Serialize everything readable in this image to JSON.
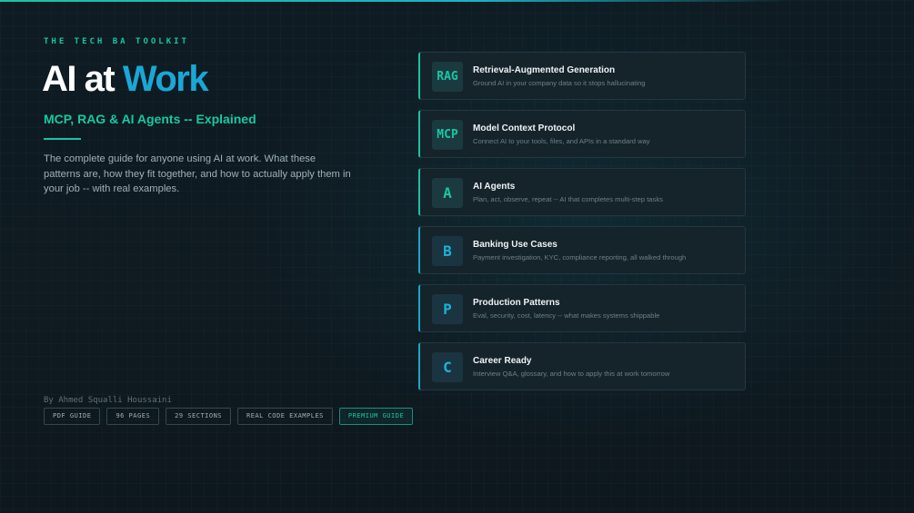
{
  "kicker": "THE TECH BA TOOLKIT",
  "title": {
    "part1": "AI at",
    "part2": "Work"
  },
  "subtitle": "MCP, RAG & AI Agents -- Explained",
  "description": "The complete guide for anyone using AI at work. What these patterns are, how they fit together, and how to actually apply them in your job -- with real examples.",
  "author": "By Ahmed Squalli Houssaini",
  "tags": [
    "PDF GUIDE",
    "96 PAGES",
    "29 SECTIONS",
    "REAL CODE EXAMPLES",
    "PREMIUM GUIDE"
  ],
  "cards": [
    {
      "icon": "RAG",
      "title": "Retrieval-Augmented Generation",
      "subtitle": "Ground AI in your company data so it stops hallucinating"
    },
    {
      "icon": "MCP",
      "title": "Model Context Protocol",
      "subtitle": "Connect AI to your tools, files, and APIs in a standard way"
    },
    {
      "icon": "A",
      "title": "AI Agents",
      "subtitle": "Plan, act, observe, repeat -- AI that completes multi-step tasks"
    },
    {
      "icon": "B",
      "title": "Banking Use Cases",
      "subtitle": "Payment investigation, KYC, compliance reporting, all walked through"
    },
    {
      "icon": "P",
      "title": "Production Patterns",
      "subtitle": "Eval, security, cost, latency -- what makes systems shippable"
    },
    {
      "icon": "C",
      "title": "Career Ready",
      "subtitle": "Interview Q&A, glossary, and how to apply this at work tomorrow"
    }
  ],
  "colors": {
    "accent_green": "#17c4a6",
    "accent_blue": "#1aa7d6",
    "background": "#0f1a21",
    "card_background": "#15232b"
  }
}
